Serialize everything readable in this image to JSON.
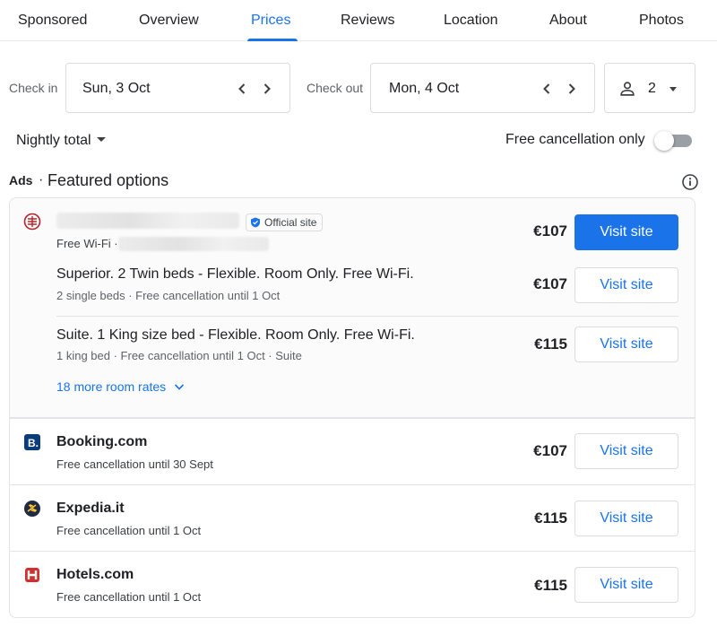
{
  "tabs": [
    {
      "label": "Sponsored"
    },
    {
      "label": "Overview"
    },
    {
      "label": "Prices"
    },
    {
      "label": "Reviews"
    },
    {
      "label": "Location"
    },
    {
      "label": "About"
    },
    {
      "label": "Photos"
    }
  ],
  "active_tab": "Prices",
  "dates": {
    "check_in_label": "Check in",
    "check_in_value": "Sun, 3 Oct",
    "check_out_label": "Check out",
    "check_out_value": "Mon, 4 Oct"
  },
  "guests": {
    "count": "2",
    "icon": "person-icon"
  },
  "filters": {
    "nightly_label": "Nightly total",
    "free_cancellation_label": "Free cancellation only",
    "free_cancellation_on": false
  },
  "section": {
    "ads_label": "Ads",
    "separator": "·",
    "title": "Featured options",
    "info_icon": "info-icon"
  },
  "featured": {
    "official_badge": "Official site",
    "wifi_prefix": "Free Wi-Fi ·",
    "price": "€107",
    "button": "Visit site",
    "rooms": [
      {
        "title": "Superior. 2 Twin beds - Flexible. Room Only. Free Wi-Fi.",
        "details": "2 single beds · Free cancellation until 1 Oct",
        "price": "€107",
        "button": "Visit site"
      },
      {
        "title": "Suite. 1 King size bed - Flexible. Room Only. Free Wi-Fi.",
        "details": "1 king bed · Free cancellation until 1 Oct · Suite",
        "price": "€115",
        "button": "Visit site"
      }
    ],
    "more_rates": "18 more room rates"
  },
  "providers": [
    {
      "name": "Booking.com",
      "details": "Free cancellation until 30 Sept",
      "price": "€107",
      "button": "Visit site",
      "logo": "booking-logo-icon",
      "color": "#0c3b7c"
    },
    {
      "name": "Expedia.it",
      "details": "Free cancellation until 1 Oct",
      "price": "€115",
      "button": "Visit site",
      "logo": "expedia-logo-icon",
      "color": "#202a44"
    },
    {
      "name": "Hotels.com",
      "details": "Free cancellation until 1 Oct",
      "price": "€115",
      "button": "Visit site",
      "logo": "hotels-logo-icon",
      "color": "#d32f2f"
    }
  ],
  "colors": {
    "accent": "#1a73e8",
    "border": "#dadce0",
    "text": "#202124",
    "muted": "#5f6368"
  }
}
